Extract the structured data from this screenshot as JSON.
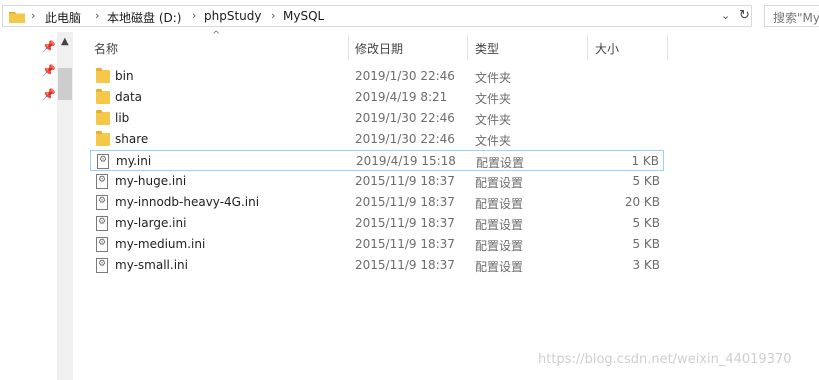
{
  "address": {
    "crumbs": [
      "此电脑",
      "本地磁盘 (D:)",
      "phpStudy",
      "MySQL"
    ],
    "separator": "›",
    "dropdown_glyph": "⌄",
    "refresh_glyph": "↻"
  },
  "search": {
    "placeholder": "搜索\"MySQL\""
  },
  "columns": {
    "name": "名称",
    "date": "修改日期",
    "type": "类型",
    "size": "大小"
  },
  "rows": [
    {
      "name": "bin",
      "date": "2019/1/30 22:46",
      "type": "文件夹",
      "size": "",
      "icon": "folder-icon"
    },
    {
      "name": "data",
      "date": "2019/4/19 8:21",
      "type": "文件夹",
      "size": "",
      "icon": "folder-icon"
    },
    {
      "name": "lib",
      "date": "2019/1/30 22:46",
      "type": "文件夹",
      "size": "",
      "icon": "folder-icon"
    },
    {
      "name": "share",
      "date": "2019/1/30 22:46",
      "type": "文件夹",
      "size": "",
      "icon": "folder-icon"
    },
    {
      "name": "my.ini",
      "date": "2019/4/19 15:18",
      "type": "配置设置",
      "size": "1 KB",
      "icon": "config-file-icon"
    },
    {
      "name": "my-huge.ini",
      "date": "2015/11/9 18:37",
      "type": "配置设置",
      "size": "5 KB",
      "icon": "config-file-icon"
    },
    {
      "name": "my-innodb-heavy-4G.ini",
      "date": "2015/11/9 18:37",
      "type": "配置设置",
      "size": "20 KB",
      "icon": "config-file-icon"
    },
    {
      "name": "my-large.ini",
      "date": "2015/11/9 18:37",
      "type": "配置设置",
      "size": "5 KB",
      "icon": "config-file-icon"
    },
    {
      "name": "my-medium.ini",
      "date": "2015/11/9 18:37",
      "type": "配置设置",
      "size": "5 KB",
      "icon": "config-file-icon"
    },
    {
      "name": "my-small.ini",
      "date": "2015/11/9 18:37",
      "type": "配置设置",
      "size": "3 KB",
      "icon": "config-file-icon"
    }
  ],
  "watermark": "https://blog.csdn.net/weixin_44019370"
}
